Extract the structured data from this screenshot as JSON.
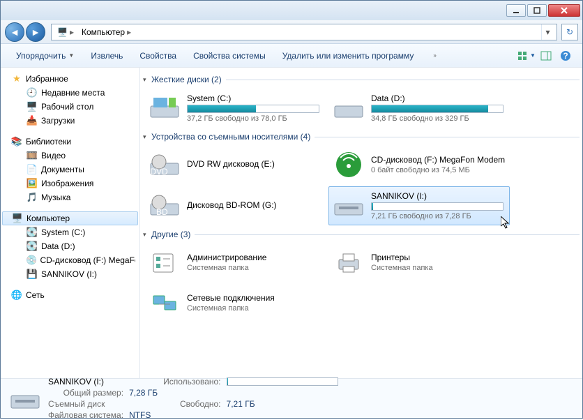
{
  "breadcrumb": {
    "root_icon": "computer",
    "item1": "Компьютер"
  },
  "toolbar": {
    "organize": "Упорядочить",
    "eject": "Извлечь",
    "properties": "Свойства",
    "sysprops": "Свойства системы",
    "uninstall": "Удалить или изменить программу"
  },
  "sidebar": {
    "favorites": {
      "label": "Избранное",
      "items": [
        "Недавние места",
        "Рабочий стол",
        "Загрузки"
      ]
    },
    "libraries": {
      "label": "Библиотеки",
      "items": [
        "Видео",
        "Документы",
        "Изображения",
        "Музыка"
      ]
    },
    "computer": {
      "label": "Компьютер",
      "items": [
        "System (C:)",
        "Data (D:)",
        "CD-дисковод (F:) MegaFon",
        "SANNIKOV (I:)"
      ]
    },
    "network": {
      "label": "Сеть"
    }
  },
  "sections": {
    "hdd": {
      "title": "Жесткие диски (2)",
      "drives": [
        {
          "label": "System (C:)",
          "sub": "37,2 ГБ свободно из 78,0 ГБ",
          "fill_pct": 52
        },
        {
          "label": "Data (D:)",
          "sub": "34,8 ГБ свободно из 329 ГБ",
          "fill_pct": 89
        }
      ]
    },
    "removable": {
      "title": "Устройства со съемными носителями (4)",
      "drives": [
        {
          "label": "DVD RW дисковод (E:)",
          "sub": ""
        },
        {
          "label": "CD-дисковод (F:) MegaFon Modem",
          "sub": "0 байт свободно из 74,5 МБ"
        },
        {
          "label": "Дисковод BD-ROM (G:)",
          "sub": ""
        },
        {
          "label": "SANNIKOV (I:)",
          "sub": "7,21 ГБ свободно из 7,28 ГБ",
          "fill_pct": 1,
          "selected": true
        }
      ]
    },
    "other": {
      "title": "Другие (3)",
      "items": [
        {
          "label": "Администрирование",
          "sub": "Системная папка"
        },
        {
          "label": "Принтеры",
          "sub": "Системная папка"
        },
        {
          "label": "Сетевые подключения",
          "sub": "Системная папка"
        }
      ]
    }
  },
  "details": {
    "name": "SANNIKOV (I:)",
    "type": "Съемный диск",
    "used_label": "Использовано:",
    "free_label": "Свободно:",
    "free_value": "7,21 ГБ",
    "total_label": "Общий размер:",
    "total_value": "7,28 ГБ",
    "fs_label": "Файловая система:",
    "fs_value": "NTFS"
  }
}
